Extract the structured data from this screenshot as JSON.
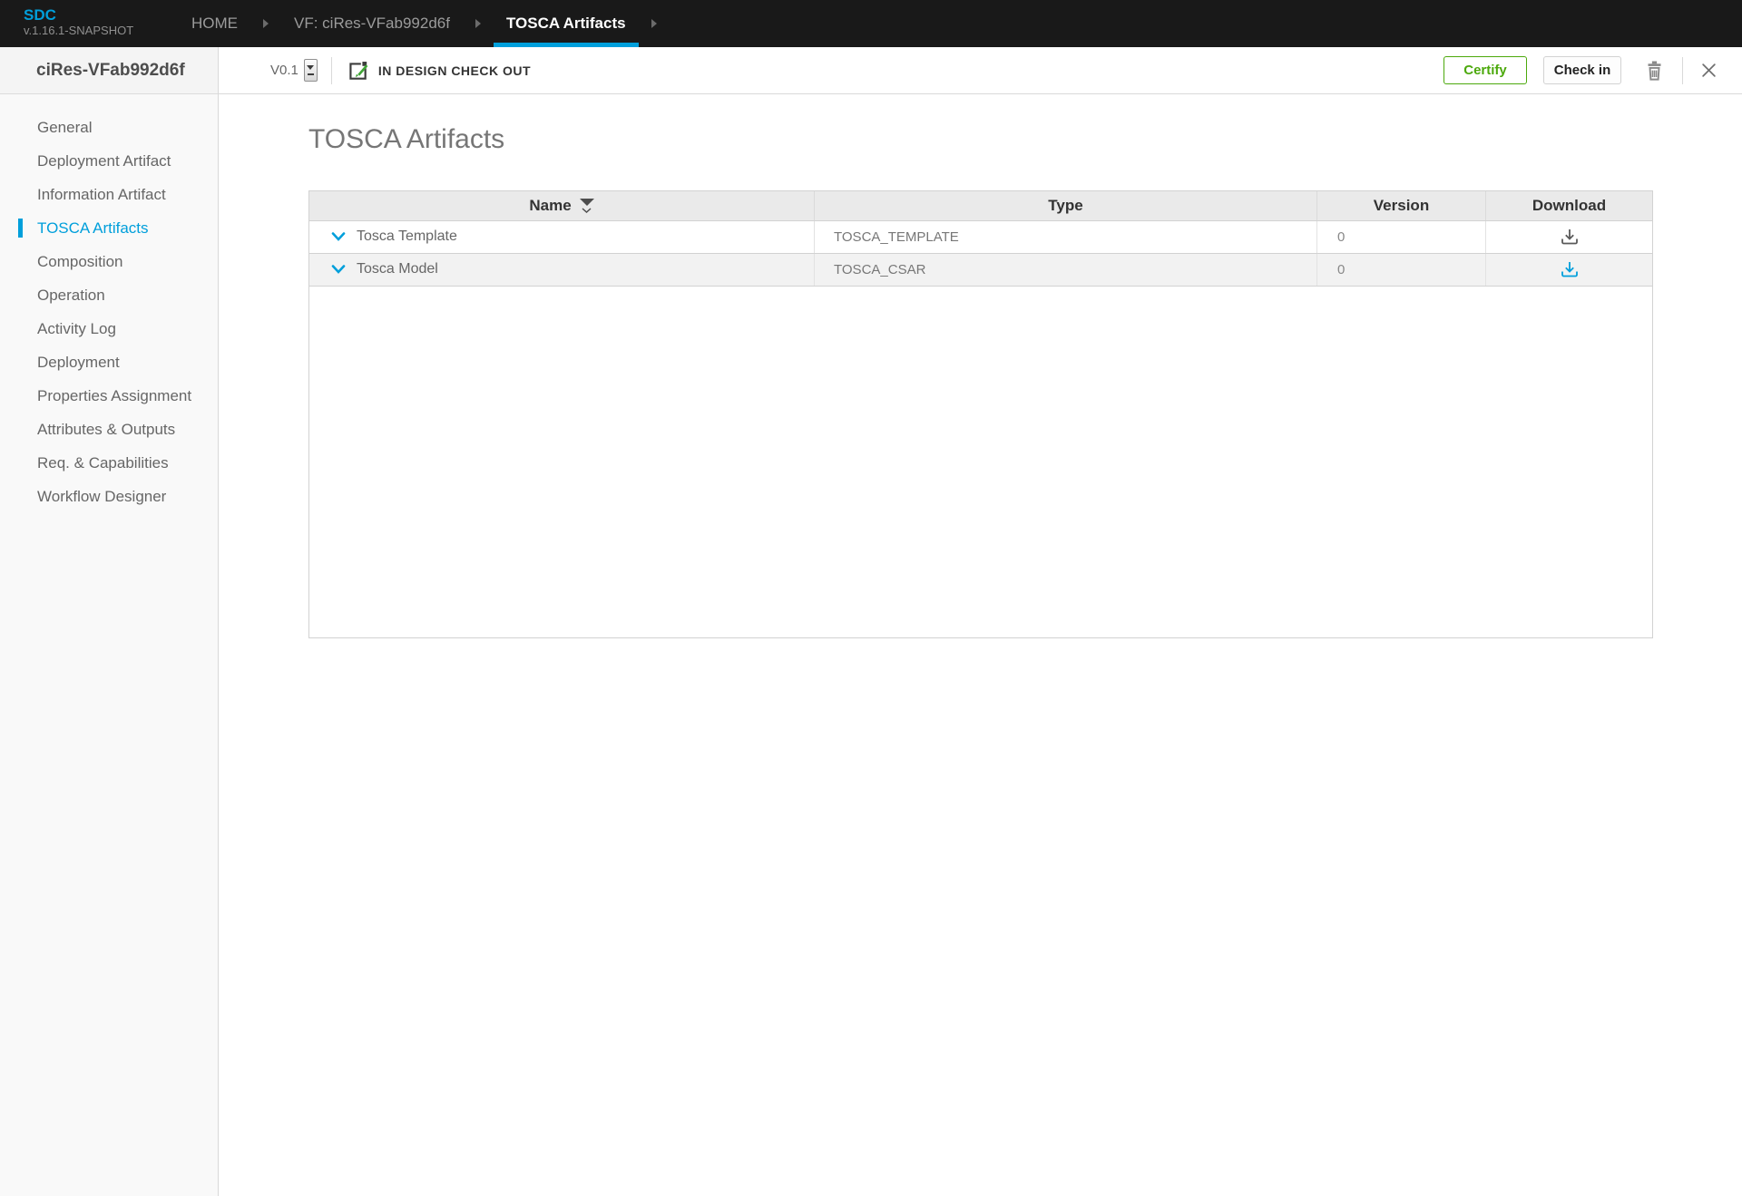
{
  "header": {
    "logo_title": "SDC",
    "logo_version": "v.1.16.1-SNAPSHOT",
    "tabs": [
      {
        "label": "HOME"
      },
      {
        "label": "VF: ciRes-VFab992d6f"
      },
      {
        "label": "TOSCA Artifacts"
      }
    ]
  },
  "sidebar": {
    "title": "ciRes-VFab992d6f",
    "items": [
      {
        "label": "General"
      },
      {
        "label": "Deployment Artifact"
      },
      {
        "label": "Information Artifact"
      },
      {
        "label": "TOSCA Artifacts"
      },
      {
        "label": "Composition"
      },
      {
        "label": "Operation"
      },
      {
        "label": "Activity Log"
      },
      {
        "label": "Deployment"
      },
      {
        "label": "Properties Assignment"
      },
      {
        "label": "Attributes & Outputs"
      },
      {
        "label": "Req. & Capabilities"
      },
      {
        "label": "Workflow Designer"
      }
    ]
  },
  "toolbar": {
    "version_label": "V0.1",
    "status_label": "IN DESIGN CHECK OUT",
    "certify_label": "Certify",
    "checkin_label": "Check in",
    "icons": [
      "version-spinner",
      "edit-checkout-icon",
      "trash-icon",
      "close-icon"
    ]
  },
  "main": {
    "page_title": "TOSCA Artifacts",
    "table": {
      "columns": [
        {
          "label": "Name"
        },
        {
          "label": "Type"
        },
        {
          "label": "Version"
        },
        {
          "label": "Download"
        }
      ],
      "rows": [
        {
          "name": "Tosca Template",
          "type": "TOSCA_TEMPLATE",
          "version": "0"
        },
        {
          "name": "Tosca Model",
          "type": "TOSCA_CSAR",
          "version": "0"
        }
      ]
    }
  },
  "colors": {
    "accent_blue": "#009fdb",
    "certify_green": "#4ca90c",
    "topbar_bg": "#191919",
    "row_alt_bg": "#f2f2f2",
    "header_row_bg": "#eaeaea"
  }
}
